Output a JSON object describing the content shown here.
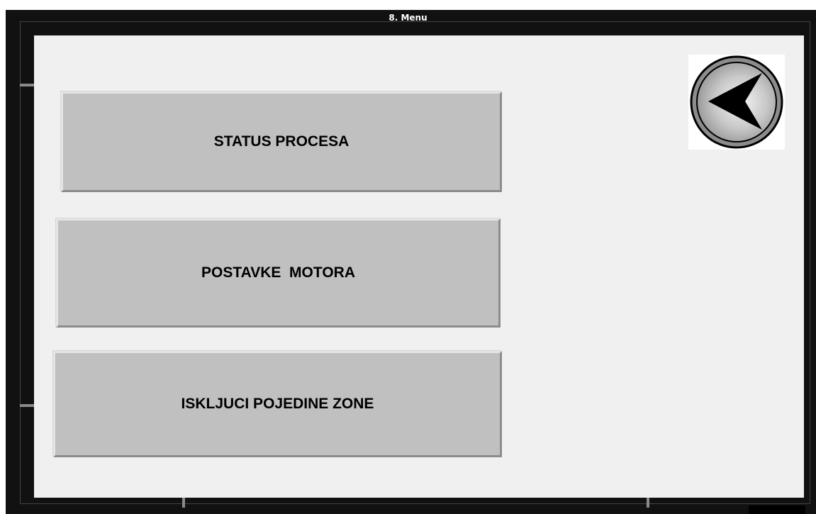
{
  "window": {
    "title": "8. Menu"
  },
  "menu": {
    "items": [
      {
        "label": "STATUS PROCESA"
      },
      {
        "label": "POSTAVKE  MOTORA"
      },
      {
        "label": "ISKLJUCI POJEDINE ZONE"
      }
    ]
  },
  "back_button": {
    "icon": "back-arrow-icon"
  },
  "colors": {
    "frame": "#111111",
    "panel": "#f0f0f0",
    "button_face": "#c0c0c0",
    "text": "#000000"
  }
}
